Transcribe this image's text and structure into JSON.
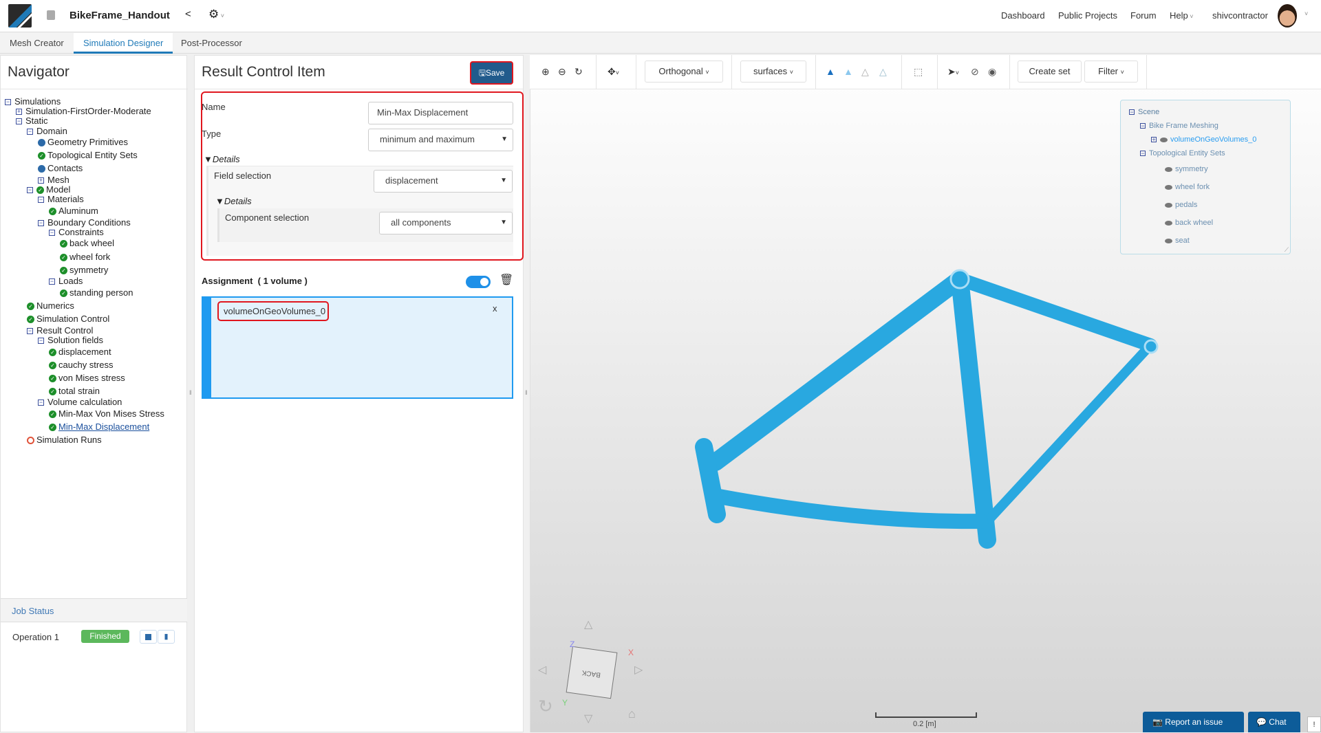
{
  "header": {
    "project_title": "BikeFrame_Handout",
    "nav": [
      "Dashboard",
      "Public Projects",
      "Forum",
      "Help"
    ],
    "username": "shivcontractor"
  },
  "tabs": [
    "Mesh Creator",
    "Simulation Designer",
    "Post-Processor"
  ],
  "navigator": {
    "title": "Navigator",
    "tree": [
      {
        "label": "Simulations",
        "level": 0,
        "icon": "minus"
      },
      {
        "label": "Simulation-FirstOrder-Moderate",
        "level": 1,
        "icon": "plus"
      },
      {
        "label": "Static",
        "level": 1,
        "icon": "minus"
      },
      {
        "label": "Domain",
        "level": 2,
        "icon": "minus"
      },
      {
        "label": "Geometry Primitives",
        "level": 3,
        "icon": "dot"
      },
      {
        "label": "Topological Entity Sets",
        "level": 3,
        "icon": "check"
      },
      {
        "label": "Contacts",
        "level": 3,
        "icon": "dot"
      },
      {
        "label": "Mesh",
        "level": 3,
        "icon": "plus"
      },
      {
        "label": "Model",
        "level": 2,
        "icon": "minus-check"
      },
      {
        "label": "Materials",
        "level": 3,
        "icon": "minus"
      },
      {
        "label": "Aluminum",
        "level": 4,
        "icon": "check"
      },
      {
        "label": "Boundary Conditions",
        "level": 3,
        "icon": "minus"
      },
      {
        "label": "Constraints",
        "level": 4,
        "icon": "minus"
      },
      {
        "label": "back wheel",
        "level": 5,
        "icon": "check"
      },
      {
        "label": "wheel fork",
        "level": 5,
        "icon": "check"
      },
      {
        "label": "symmetry",
        "level": 5,
        "icon": "check"
      },
      {
        "label": "Loads",
        "level": 4,
        "icon": "minus"
      },
      {
        "label": "standing person",
        "level": 5,
        "icon": "check"
      },
      {
        "label": "Numerics",
        "level": 2,
        "icon": "check"
      },
      {
        "label": "Simulation Control",
        "level": 2,
        "icon": "check"
      },
      {
        "label": "Result Control",
        "level": 2,
        "icon": "minus"
      },
      {
        "label": "Solution fields",
        "level": 3,
        "icon": "minus"
      },
      {
        "label": "displacement",
        "level": 4,
        "icon": "check"
      },
      {
        "label": "cauchy stress",
        "level": 4,
        "icon": "check"
      },
      {
        "label": "von Mises stress",
        "level": 4,
        "icon": "check"
      },
      {
        "label": "total strain",
        "level": 4,
        "icon": "check"
      },
      {
        "label": "Volume calculation",
        "level": 3,
        "icon": "minus"
      },
      {
        "label": "Min-Max Von Mises Stress",
        "level": 4,
        "icon": "check"
      },
      {
        "label": "Min-Max Displacement",
        "level": 4,
        "icon": "check",
        "selected": true
      },
      {
        "label": "Simulation Runs",
        "level": 2,
        "icon": "ring"
      }
    ]
  },
  "job_status": {
    "title": "Job Status",
    "operation": "Operation 1",
    "status": "Finished"
  },
  "editor": {
    "title": "Result Control Item",
    "save_label": "Save",
    "name_label": "Name",
    "name_value": "Min-Max Displacement",
    "type_label": "Type",
    "type_value": "minimum and maximum",
    "details_label": "Details",
    "field_label": "Field selection",
    "field_value": "displacement",
    "details2_label": "Details",
    "component_label": "Component selection",
    "component_value": "all components",
    "assignment_label": "Assignment",
    "assignment_count": "( 1 volume )",
    "assigned_item": "volumeOnGeoVolumes_0",
    "remove_label": "x"
  },
  "toolbar": {
    "projection": "Orthogonal",
    "render_mode": "surfaces",
    "create_set": "Create set",
    "filter": "Filter"
  },
  "scene": {
    "root": "Scene",
    "group1": "Bike Frame Meshing",
    "volume": "volumeOnGeoVolumes_0",
    "group2": "Topological Entity Sets",
    "sets": [
      "symmetry",
      "wheel fork",
      "pedals",
      "back wheel",
      "seat"
    ]
  },
  "viewer": {
    "scale_label": "0.2 [m]",
    "cube_face": "BACK",
    "axes": [
      "X",
      "Y",
      "Z"
    ],
    "frame_color": "#29a8e0"
  },
  "footer": {
    "report": "Report an issue",
    "chat": "Chat",
    "feedback": "!"
  }
}
